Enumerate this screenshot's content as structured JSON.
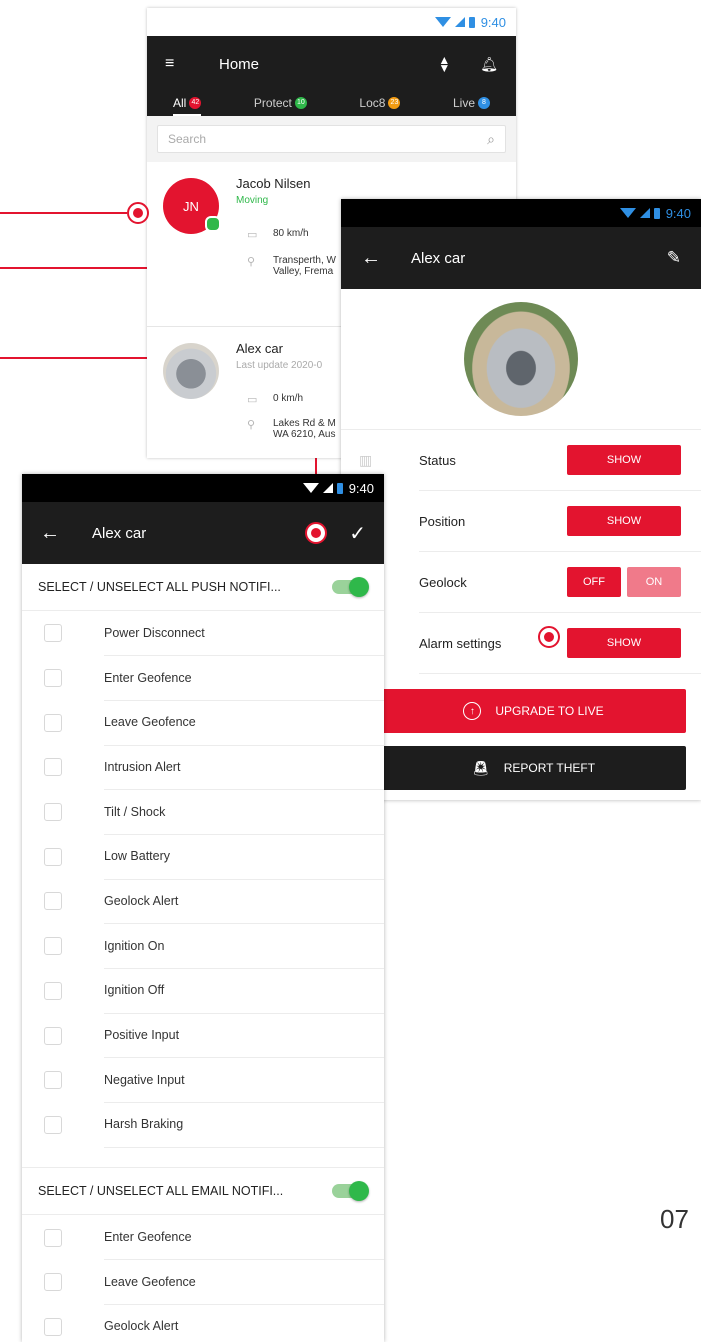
{
  "home": {
    "status_time": "9:40",
    "title": "Home",
    "tabs": [
      {
        "label": "All",
        "badge": "42",
        "badge_color": "#e3142f"
      },
      {
        "label": "Protect",
        "badge": "10",
        "badge_color": "#2fb84a"
      },
      {
        "label": "Loc8",
        "badge": "23",
        "badge_color": "#f39c12"
      },
      {
        "label": "Live",
        "badge": "8",
        "badge_color": "#2f8fe3"
      }
    ],
    "search_placeholder": "Search",
    "devices": [
      {
        "initials": "JN",
        "name": "Jacob Nilsen",
        "status": "Moving",
        "speed": "80 km/h",
        "address_line1": "Transperth, W",
        "address_line2": "Valley, Frema"
      },
      {
        "name": "Alex car",
        "status": "Last update 2020-0",
        "speed": "0 km/h",
        "address_line1": "Lakes Rd & M",
        "address_line2": "WA 6210, Aus"
      }
    ]
  },
  "detail": {
    "status_time": "9:40",
    "title": "Alex car",
    "rows": [
      {
        "label": "Status",
        "button": "SHOW"
      },
      {
        "label": "Position",
        "button": "SHOW"
      },
      {
        "label": "Geolock",
        "off_label": "OFF",
        "on_label": "ON"
      },
      {
        "label": "Alarm settings",
        "button": "SHOW"
      }
    ],
    "upgrade_label": "UPGRADE TO LIVE",
    "report_label": "REPORT THEFT"
  },
  "notif": {
    "status_time": "9:40",
    "title": "Alex car",
    "push_header": "SELECT / UNSELECT ALL PUSH NOTIFI...",
    "push_items": [
      "Power Disconnect",
      "Enter Geofence",
      "Leave Geofence",
      "Intrusion Alert",
      "Tilt / Shock",
      "Low Battery",
      "Geolock Alert",
      "Ignition On",
      "Ignition Off",
      "Positive Input",
      "Negative Input",
      "Harsh Braking"
    ],
    "email_header": "SELECT / UNSELECT ALL EMAIL NOTIFI...",
    "email_items": [
      "Enter Geofence",
      "Leave Geofence",
      "Geolock Alert"
    ]
  },
  "page_number": "07",
  "colors": {
    "accent": "#e3142f",
    "toolbar": "#1d1d1d",
    "toggle_on": "#2fb84a"
  }
}
